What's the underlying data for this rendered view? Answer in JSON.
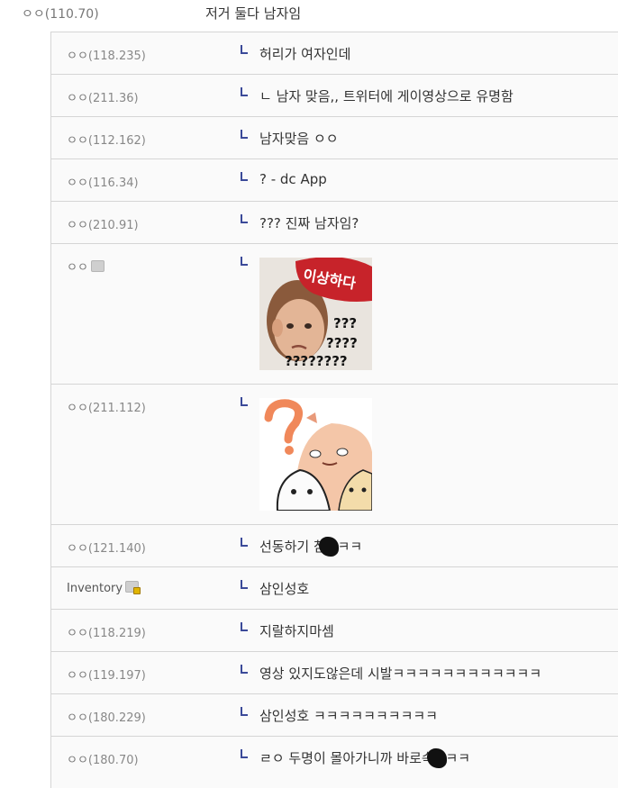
{
  "top_comment": {
    "nick": "ㅇㅇ",
    "ip": "(110.70)",
    "text": "저거 둘다 남자임"
  },
  "replies": [
    {
      "nick": "ㅇㅇ",
      "ip": "(118.235)",
      "text": "허리가 여자인데"
    },
    {
      "nick": "ㅇㅇ",
      "ip": "(211.36)",
      "text": "ㄴ 남자 맞음,, 트위터에 게이영상으로 유명함"
    },
    {
      "nick": "ㅇㅇ",
      "ip": "(112.162)",
      "text": "남자맞음 ㅇㅇ"
    },
    {
      "nick": "ㅇㅇ",
      "ip": "(116.34)",
      "text": "? - dc App"
    },
    {
      "nick": "ㅇㅇ",
      "ip": "(210.91)",
      "text": "??? 진짜 남자임?"
    },
    {
      "nick": "ㅇㅇ",
      "ip": "",
      "sticker_bubble": "이상하다",
      "sticker_q": [
        "???",
        "????",
        "????????"
      ]
    },
    {
      "nick": "ㅇㅇ",
      "ip": "(211.112)",
      "sticker": "question-bun"
    },
    {
      "nick": "ㅇㅇ",
      "ip": "(121.140)",
      "text_a": "선동하기 참",
      "text_b": "ㅋㅋ"
    },
    {
      "nick": "Inventory",
      "ip": "",
      "text": "삼인성호"
    },
    {
      "nick": "ㅇㅇ",
      "ip": "(118.219)",
      "text": "지랄하지마셈"
    },
    {
      "nick": "ㅇㅇ",
      "ip": "(119.197)",
      "text": "영상 있지도않은데 시발ㅋㅋㅋㅋㅋㅋㅋㅋㅋㅋㅋㅋ"
    },
    {
      "nick": "ㅇㅇ",
      "ip": "(180.229)",
      "text": "삼인성호 ㅋㅋㅋㅋㅋㅋㅋㅋㅋㅋ"
    },
    {
      "nick": "ㅇㅇ",
      "ip": "(180.70)",
      "text_a": "ㄹㅇ 두명이 몰아가니까 바로속",
      "text_b": "ㅋㅋ"
    }
  ]
}
